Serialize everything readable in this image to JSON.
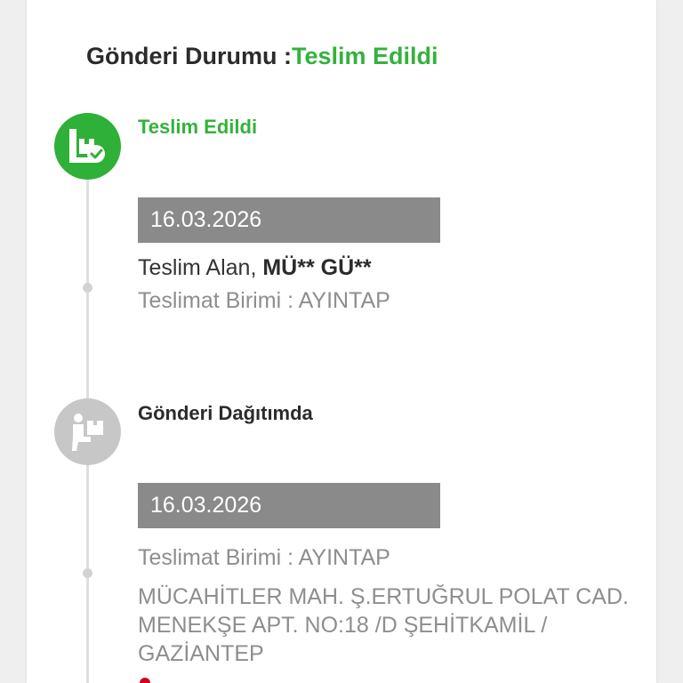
{
  "status": {
    "label": "Gönderi Durumu :",
    "value": "Teslim Edildi",
    "value_color": "#34b23c"
  },
  "steps": [
    {
      "icon": "package-delivered-icon",
      "title": "Teslim Edildi",
      "date": "16.03.2026",
      "recipient_label": "Teslim Alan, ",
      "recipient_name": "MÜ** GÜ**",
      "unit": "Teslimat Birimi : AYINTAP"
    },
    {
      "icon": "courier-package-icon",
      "title": "Gönderi Dağıtımda",
      "date": "16.03.2026",
      "unit": "Teslimat Birimi : AYINTAP",
      "address": "MÜCAHİTLER MAH. Ş.ERTUĞRUL POLAT CAD. MENEKŞE APT. NO:18 /D ŞEHİTKAMİL / GAZİANTEP"
    }
  ],
  "colors": {
    "accent_green": "#34b23c",
    "pending_grey": "#c7c7c7",
    "date_bar": "#8a8a8a",
    "location_red": "#d0021b"
  }
}
